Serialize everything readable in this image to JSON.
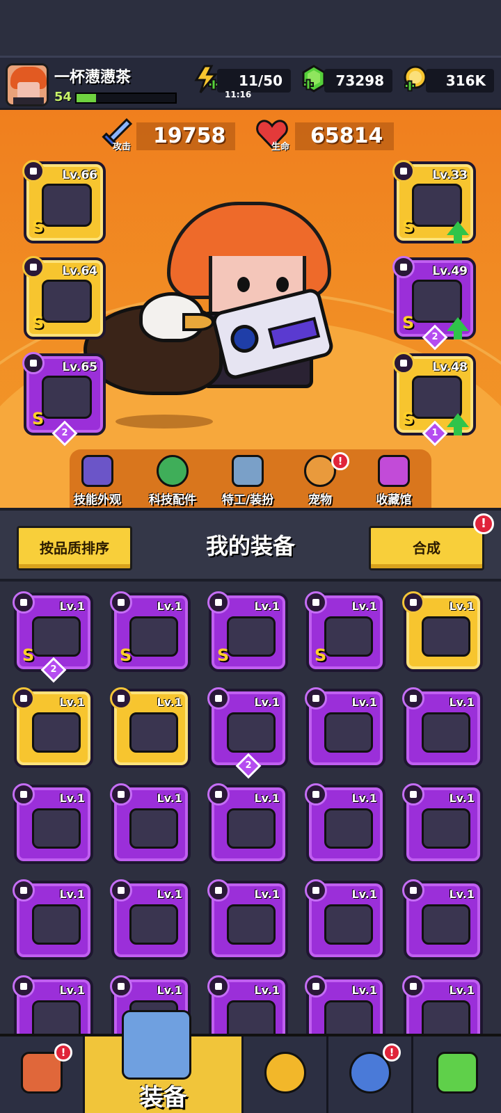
{
  "player": {
    "name": "一杯懑懑茶",
    "level": "54",
    "xp_fraction": 0.2
  },
  "resources": {
    "energy": "11/50",
    "energy_timer": "11:16",
    "gems": "73298",
    "coins": "316K"
  },
  "stats": {
    "attack_label": "攻击",
    "attack": "19758",
    "hp_label": "生命",
    "hp": "65814"
  },
  "equipped": {
    "left": [
      {
        "lv": "Lv.66",
        "grade": "S",
        "rarity": "gold"
      },
      {
        "lv": "Lv.64",
        "grade": "S",
        "rarity": "gold"
      },
      {
        "lv": "Lv.65",
        "grade": "S",
        "rarity": "purple",
        "stars": "2"
      }
    ],
    "right": [
      {
        "lv": "Lv.33",
        "grade": "S",
        "rarity": "gold"
      },
      {
        "lv": "Lv.49",
        "grade": "S",
        "rarity": "purple",
        "stars": "2"
      },
      {
        "lv": "Lv.48",
        "grade": "S",
        "rarity": "gold",
        "stars": "1"
      }
    ]
  },
  "features": [
    {
      "label": "技能外观"
    },
    {
      "label": "科技配件"
    },
    {
      "label": "特工/装扮"
    },
    {
      "label": "宠物",
      "badge": "!"
    },
    {
      "label": "收藏馆"
    }
  ],
  "equip_panel": {
    "sort_button": "按品质排序",
    "title": "我的装备",
    "merge_button": "合成",
    "merge_badge": "!"
  },
  "inventory": [
    {
      "lv": "Lv.1",
      "grade": "S",
      "rarity": "purple",
      "stars": "2"
    },
    {
      "lv": "Lv.1",
      "grade": "S",
      "rarity": "purple"
    },
    {
      "lv": "Lv.1",
      "grade": "S",
      "rarity": "purple"
    },
    {
      "lv": "Lv.1",
      "grade": "S",
      "rarity": "purple"
    },
    {
      "lv": "Lv.1",
      "rarity": "gold"
    },
    {
      "lv": "Lv.1",
      "rarity": "gold"
    },
    {
      "lv": "Lv.1",
      "rarity": "gold"
    },
    {
      "lv": "Lv.1",
      "rarity": "purple",
      "stars": "2"
    },
    {
      "lv": "Lv.1",
      "rarity": "purple"
    },
    {
      "lv": "Lv.1",
      "rarity": "purple"
    },
    {
      "lv": "Lv.1",
      "rarity": "purple"
    },
    {
      "lv": "Lv.1",
      "rarity": "purple"
    },
    {
      "lv": "Lv.1",
      "rarity": "purple"
    },
    {
      "lv": "Lv.1",
      "rarity": "purple"
    },
    {
      "lv": "Lv.1",
      "rarity": "purple"
    },
    {
      "lv": "Lv.1",
      "rarity": "purple"
    },
    {
      "lv": "Lv.1",
      "rarity": "purple"
    },
    {
      "lv": "Lv.1",
      "rarity": "purple"
    },
    {
      "lv": "Lv.1",
      "rarity": "purple"
    },
    {
      "lv": "Lv.1",
      "rarity": "purple"
    },
    {
      "lv": "Lv.1",
      "rarity": "purple"
    },
    {
      "lv": "Lv.1",
      "rarity": "purple"
    },
    {
      "lv": "Lv.1",
      "rarity": "purple"
    },
    {
      "lv": "Lv.1",
      "rarity": "purple"
    },
    {
      "lv": "Lv.1",
      "rarity": "purple"
    }
  ],
  "nav": {
    "equip_label": "装备",
    "shop_badge": "!",
    "pet_badge": "!"
  },
  "colors": {
    "gold_slot": "#f7c52f",
    "purple_slot": "#9b2fd9",
    "hero_bg": "#f07f1e"
  }
}
